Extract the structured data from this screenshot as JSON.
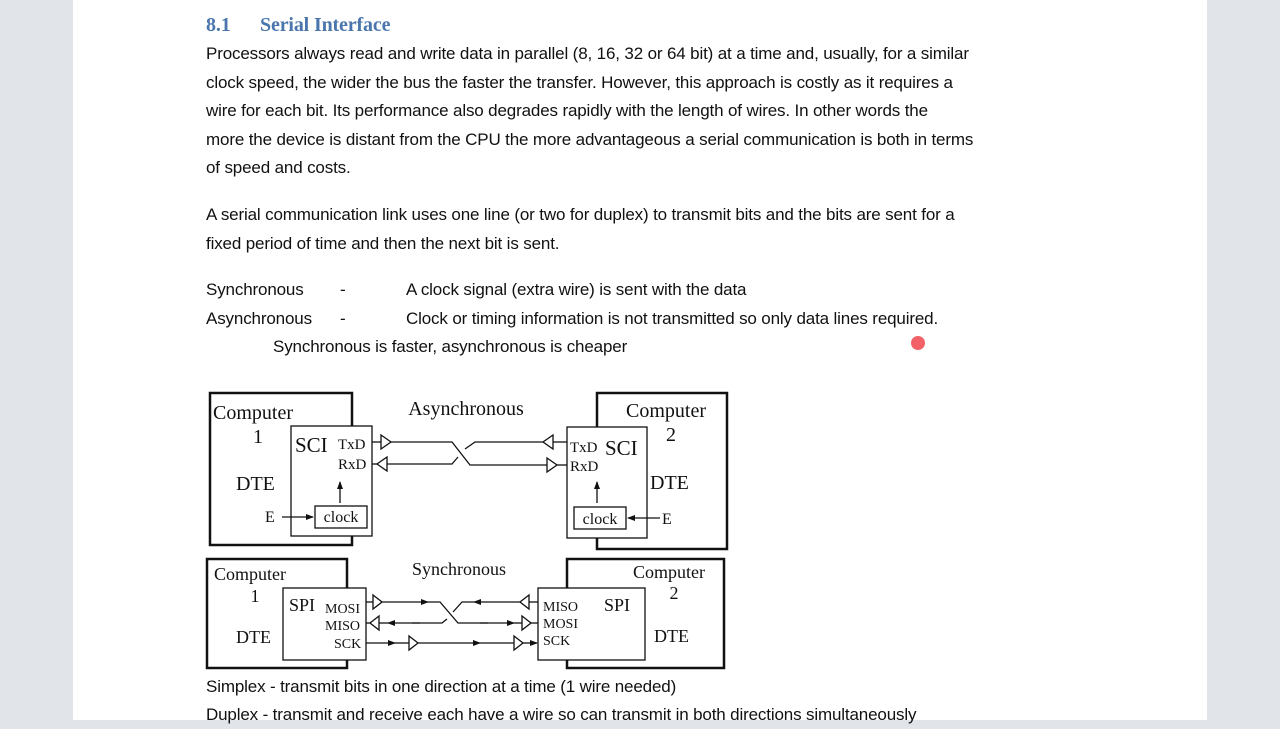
{
  "section": {
    "number": "8.1",
    "title": "Serial Interface"
  },
  "paragraphs": {
    "intro": [
      "Processors always read and write data in parallel (8, 16, 32 or 64 bit) at a time and, usually, for a similar",
      "clock speed, the wider the bus the faster the transfer. However, this approach is costly as it requires a",
      "wire for each bit. Its performance also degrades rapidly with the length of wires. In other words the",
      "more the device is distant from the CPU the more advantageous a serial communication is both in terms",
      "of speed and costs."
    ],
    "link": [
      "A serial communication link uses one line (or two for duplex) to transmit bits and the bits are sent for a",
      "fixed period of time and then the next bit is sent."
    ]
  },
  "definitions": [
    {
      "term": "Synchronous",
      "dash": "-",
      "desc": "A clock signal (extra wire) is sent with the data"
    },
    {
      "term": "Asynchronous",
      "dash": "-",
      "desc": "Clock or timing information is not transmitted so only data lines required."
    }
  ],
  "note": "Synchronous is faster, asynchronous is cheaper",
  "diagram": {
    "async": {
      "title": "Asynchronous",
      "left": {
        "computer": "Computer",
        "number": "1",
        "dte": "DTE",
        "module": "SCI",
        "tx": "TxD",
        "rx": "RxD",
        "clock": "clock",
        "enable": "E"
      },
      "right": {
        "computer": "Computer",
        "number": "2",
        "dte": "DTE",
        "module": "SCI",
        "tx": "TxD",
        "rx": "RxD",
        "clock": "clock",
        "enable": "E"
      }
    },
    "sync": {
      "title": "Synchronous",
      "left": {
        "computer": "Computer",
        "number": "1",
        "dte": "DTE",
        "module": "SPI",
        "mosi": "MOSI",
        "miso": "MISO",
        "sck": "SCK"
      },
      "right": {
        "computer": "Computer",
        "number": "2",
        "dte": "DTE",
        "module": "SPI",
        "miso": "MISO",
        "mosi": "MOSI",
        "sck": "SCK"
      }
    }
  },
  "footer": [
    "Simplex - transmit bits in one direction at a time (1 wire needed)",
    "Duplex  - transmit and receive each have a wire so can transmit in both directions simultaneously"
  ],
  "colors": {
    "heading": "#4a76ad",
    "background": "#e1e5ea",
    "laser_pointer": "#f0545a"
  }
}
